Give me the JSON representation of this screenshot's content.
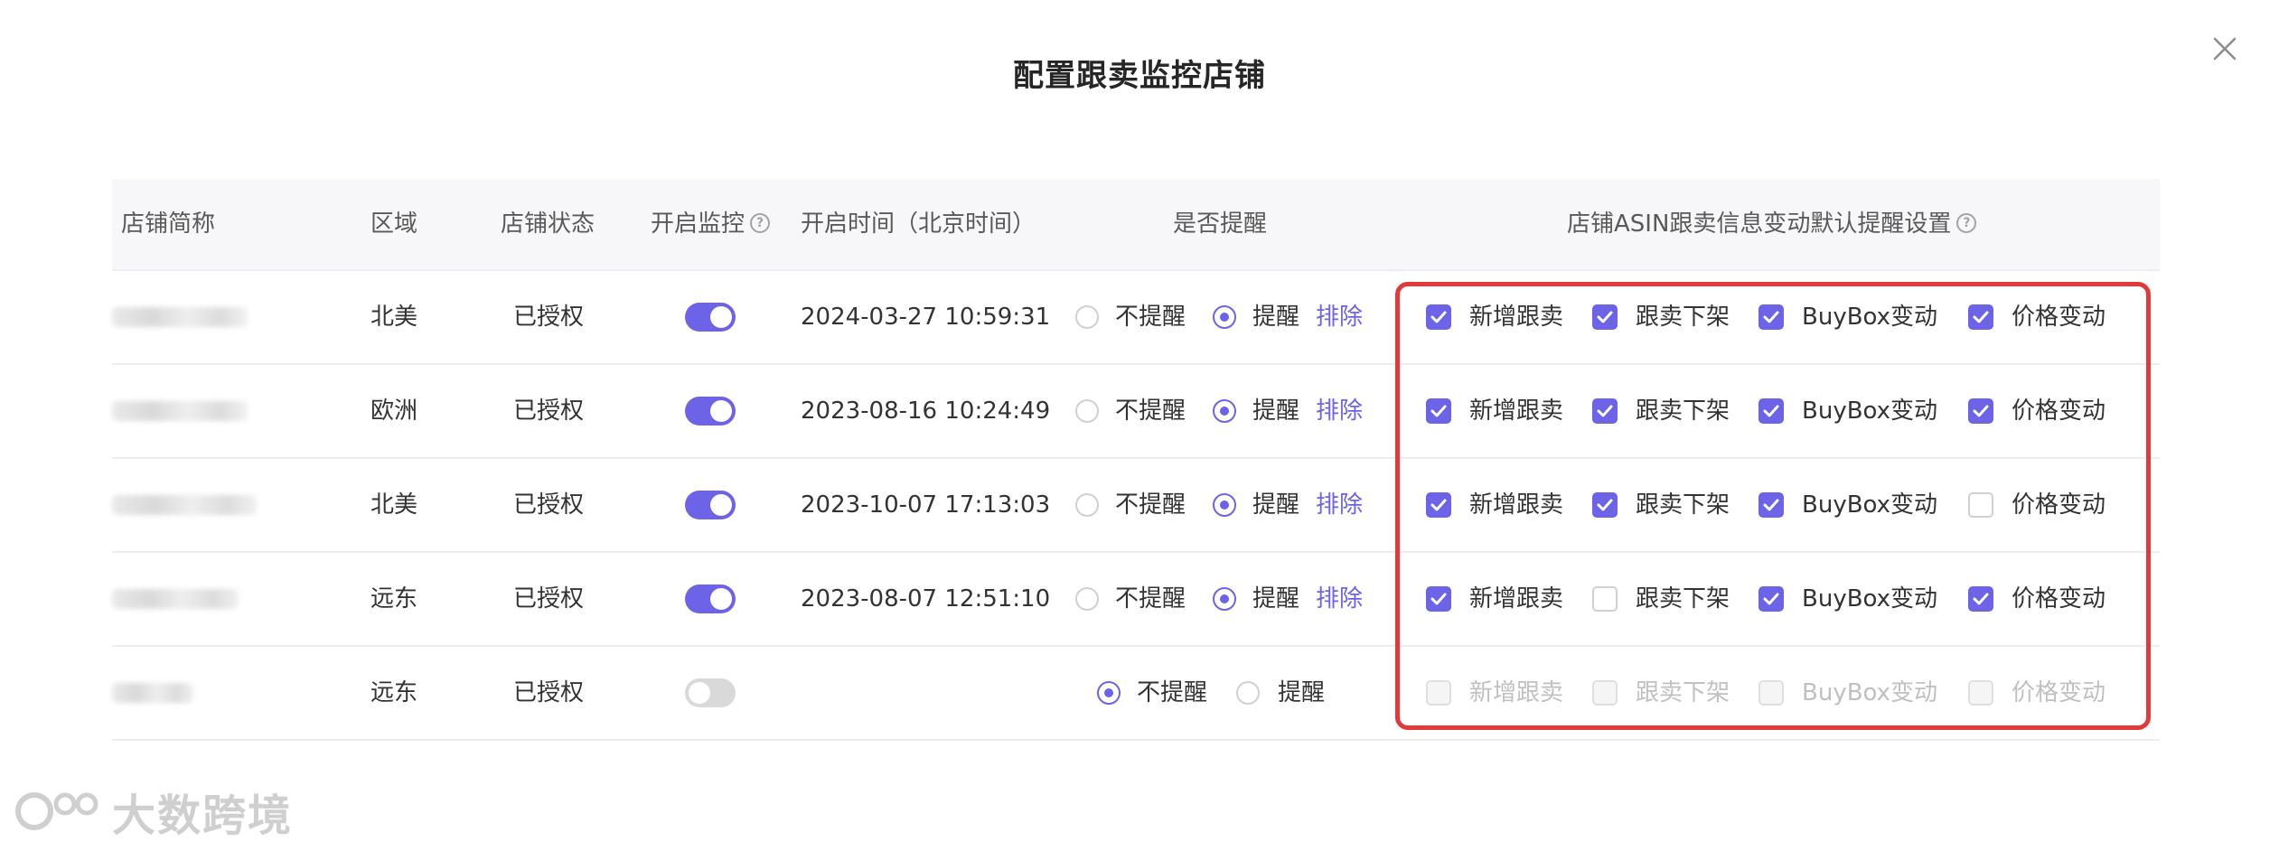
{
  "modal": {
    "title": "配置跟卖监控店铺",
    "close_icon": "close-icon"
  },
  "table": {
    "headers": {
      "store": "店铺简称",
      "region": "区域",
      "status": "店铺状态",
      "monitor": "开启监控",
      "time": "开启时间（北京时间）",
      "remind": "是否提醒",
      "settings": "店铺ASIN跟卖信息变动默认提醒设置"
    },
    "options": {
      "no_remind": "不提醒",
      "remind": "提醒",
      "exclude": "排除",
      "new_follow": "新增跟卖",
      "follow_off": "跟卖下架",
      "buybox": "BuyBox变动",
      "price": "价格变动"
    },
    "rows": [
      {
        "region": "北美",
        "status": "已授权",
        "monitor": true,
        "time": "2024-03-27 10:59:31",
        "remind": true,
        "new_follow": true,
        "follow_off": true,
        "buybox": true,
        "price": true,
        "disabled": false
      },
      {
        "region": "欧洲",
        "status": "已授权",
        "monitor": true,
        "time": "2023-08-16 10:24:49",
        "remind": true,
        "new_follow": true,
        "follow_off": true,
        "buybox": true,
        "price": true,
        "disabled": false
      },
      {
        "region": "北美",
        "status": "已授权",
        "monitor": true,
        "time": "2023-10-07 17:13:03",
        "remind": true,
        "new_follow": true,
        "follow_off": true,
        "buybox": true,
        "price": false,
        "disabled": false
      },
      {
        "region": "远东",
        "status": "已授权",
        "monitor": true,
        "time": "2023-08-07 12:51:10",
        "remind": true,
        "new_follow": true,
        "follow_off": false,
        "buybox": true,
        "price": true,
        "disabled": false
      },
      {
        "region": "远东",
        "status": "已授权",
        "monitor": false,
        "time": "",
        "remind": false,
        "new_follow": false,
        "follow_off": false,
        "buybox": false,
        "price": false,
        "disabled": true
      }
    ]
  },
  "colors": {
    "accent": "#6c63e6",
    "highlight": "#e5383b"
  },
  "watermark": {
    "text": "大数跨境"
  }
}
